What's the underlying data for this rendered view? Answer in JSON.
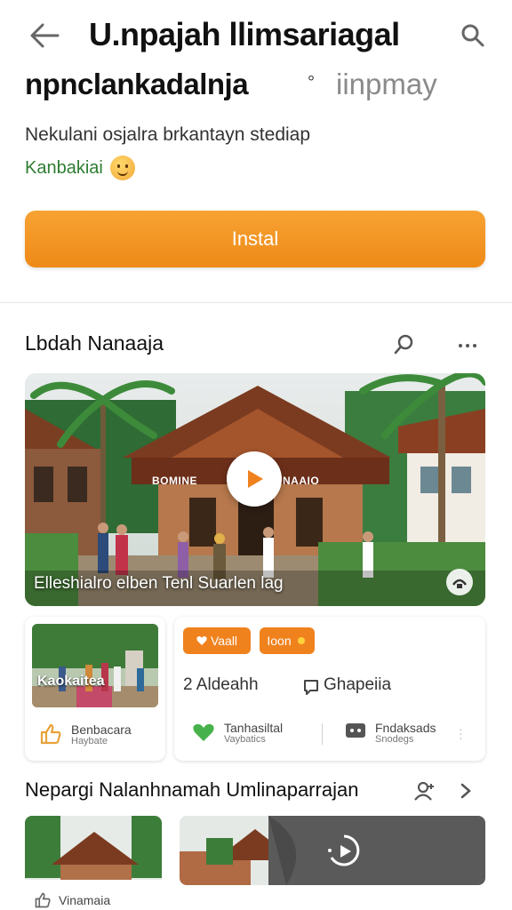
{
  "header": {
    "title_line1": "U.npajah llimsariagal",
    "title_line2": "npnclankadalnja",
    "title_separator": "°",
    "title_sub": "iinpmay",
    "description": "Nekulani osjalra brkantayn stediap",
    "rating_label": "Kanbakiai",
    "install_label": "Instal"
  },
  "section1": {
    "title": "Lbdah Nanaaja",
    "video": {
      "sign_left": "BOMINE",
      "sign_right": "NAAIO",
      "caption": "Elleshialro elben Tenl Suarlen lag"
    }
  },
  "cards": {
    "left": {
      "thumb_label": "Kaokaitea",
      "row_title": "Benbacara",
      "row_sub": "Haybate"
    },
    "right": {
      "chip1": "Vaall",
      "chip2": "Ioon",
      "stat1": "2 Aldeahh",
      "stat2": "Ghapeiia",
      "row1_title": "Tanhasiltal",
      "row1_sub": "Vaybatics",
      "row2_title": "Fndaksads",
      "row2_sub": "Snodegs"
    }
  },
  "section2": {
    "title": "Nepargi Nalanhnamah Umlinaparrajan",
    "bottom_label": "Vinamaia"
  },
  "colors": {
    "accent_orange": "#f0821e",
    "rating_green": "#2e7d32"
  },
  "icons": [
    "back-arrow-icon",
    "search-icon",
    "smiley-icon",
    "pin-icon",
    "more-icon",
    "play-icon",
    "thumbs-up-icon",
    "heart-icon",
    "chat-icon",
    "share-icon",
    "chevron-right-icon",
    "user-add-icon"
  ]
}
